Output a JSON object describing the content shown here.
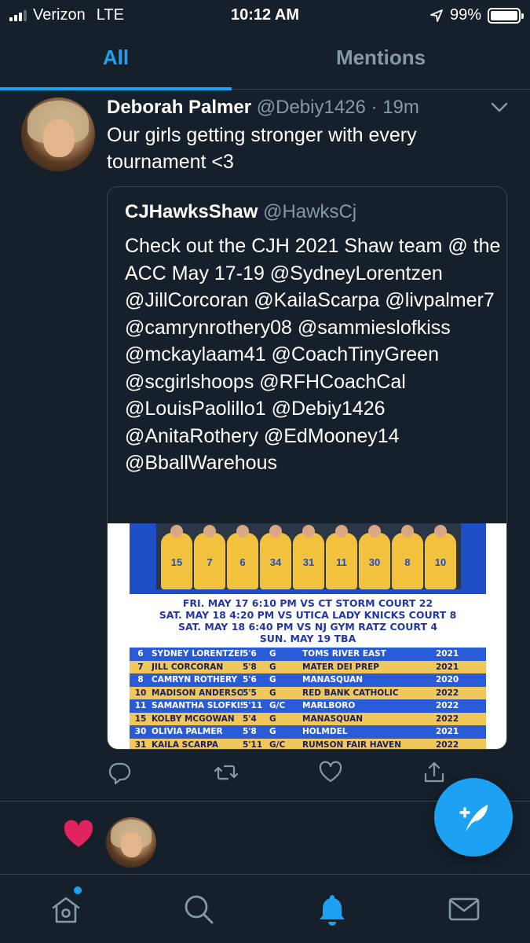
{
  "status_bar": {
    "carrier": "Verizon",
    "network": "LTE",
    "time": "10:12 AM",
    "battery": "99%",
    "battery_level": 0.99
  },
  "tabs": {
    "all": "All",
    "mentions": "Mentions",
    "active": "all"
  },
  "tweet": {
    "author_name": "Deborah Palmer",
    "author_handle": "@Debiy1426",
    "time_ago": "· 19m",
    "text": "Our girls getting stronger with every tournament <3",
    "quote": {
      "author_name": "CJHawksShaw",
      "author_handle": "@HawksCj",
      "text": "Check out the CJH 2021 Shaw team @ the ACC May 17-19 @SydneyLorentzen @JillCorcoran @KailaScarpa @livpalmer7 @camrynrothery08 @sammieslofkiss @mckaylaam41 @CoachTinyGreen @scgirlshoops @RFHCoachCal @LouisPaolillo1 @Debiy1426 @AnitaRothery @EdMooney14 @BballWarehous",
      "image": {
        "jersey_numbers": [
          "15",
          "7",
          "6",
          "34",
          "31",
          "11",
          "30",
          "8",
          "10"
        ],
        "schedule": [
          "FRI. MAY 17 6:10 PM VS CT STORM COURT 22",
          "SAT. MAY 18 4:20 PM VS UTICA LADY KNICKS COURT 8",
          "SAT. MAY 18 6:40 PM VS NJ GYM RATZ COURT 4",
          "SUN. MAY 19 TBA"
        ],
        "roster": [
          {
            "num": "6",
            "name": "SYDNEY LORENTZEN",
            "height": "5'6",
            "pos": "G",
            "school": "TOMS RIVER EAST",
            "year": "2021",
            "style": "blue"
          },
          {
            "num": "7",
            "name": "JILL CORCORAN",
            "height": "5'8",
            "pos": "G",
            "school": "MATER DEI PREP",
            "year": "2021",
            "style": "gold"
          },
          {
            "num": "8",
            "name": "CAMRYN ROTHERY",
            "height": "5'6",
            "pos": "G",
            "school": "MANASQUAN",
            "year": "2020",
            "style": "blue"
          },
          {
            "num": "10",
            "name": "MADISON ANDERSON",
            "height": "5'5",
            "pos": "G",
            "school": "RED BANK CATHOLIC",
            "year": "2022",
            "style": "gold"
          },
          {
            "num": "11",
            "name": "SAMANTHA SLOFKISS",
            "height": "5'11",
            "pos": "G/C",
            "school": "MARLBORO",
            "year": "2022",
            "style": "blue"
          },
          {
            "num": "15",
            "name": "KOLBY MCGOWAN",
            "height": "5'4",
            "pos": "G",
            "school": "MANASQUAN",
            "year": "2022",
            "style": "gold"
          },
          {
            "num": "30",
            "name": "OLIVIA PALMER",
            "height": "5'8",
            "pos": "G",
            "school": "HOLMDEL",
            "year": "2021",
            "style": "blue"
          },
          {
            "num": "31",
            "name": "KAILA SCARPA",
            "height": "5'11",
            "pos": "G/C",
            "school": "RUMSON FAIR HAVEN",
            "year": "2022",
            "style": "gold"
          }
        ]
      }
    }
  },
  "icons": {
    "reply": "reply-icon",
    "retweet": "retweet-icon",
    "like": "like-icon",
    "share": "share-icon",
    "liked_heart": "heart-filled-icon",
    "compose": "compose-tweet-icon",
    "home": "home-icon",
    "search": "search-icon",
    "notifications": "bell-icon",
    "messages": "mail-icon"
  },
  "colors": {
    "background": "#15202b",
    "accent": "#1da1f2",
    "muted": "#8899a6",
    "heart": "#e0245e",
    "divider": "#38444d"
  }
}
